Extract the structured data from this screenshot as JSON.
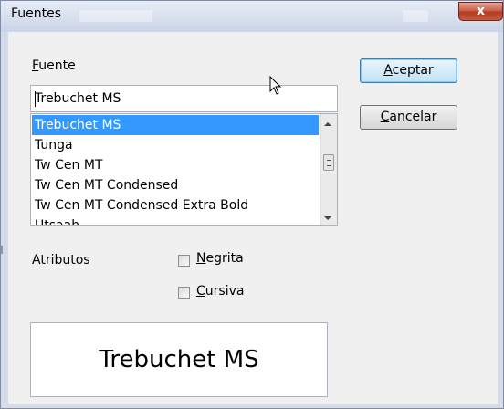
{
  "window": {
    "title": "Fuentes",
    "close_glyph": "x"
  },
  "font_field": {
    "label_accel": "F",
    "label_rest": "uente",
    "value": "Trebuchet MS"
  },
  "font_list": {
    "items": [
      "Trebuchet MS",
      "Tunga",
      "Tw Cen MT",
      "Tw Cen MT Condensed",
      "Tw Cen MT Condensed Extra Bold",
      "Utsaah"
    ],
    "selected_index": 0
  },
  "buttons": {
    "ok_accel": "A",
    "ok_rest": "ceptar",
    "cancel_accel": "C",
    "cancel_rest": "ancelar"
  },
  "attributes": {
    "label": "Atributos",
    "bold_accel": "N",
    "bold_rest": "egrita",
    "bold_checked": false,
    "italic_accel": "C",
    "italic_rest": "ursiva",
    "italic_checked": false
  },
  "preview": {
    "text": "Trebuchet MS"
  },
  "colors": {
    "selection": "#3399ff",
    "dialog_bg": "#f0f0f0",
    "close_red": "#c85a43"
  },
  "icons": {
    "cursor": "arrow-cursor-icon",
    "close": "close-icon"
  }
}
